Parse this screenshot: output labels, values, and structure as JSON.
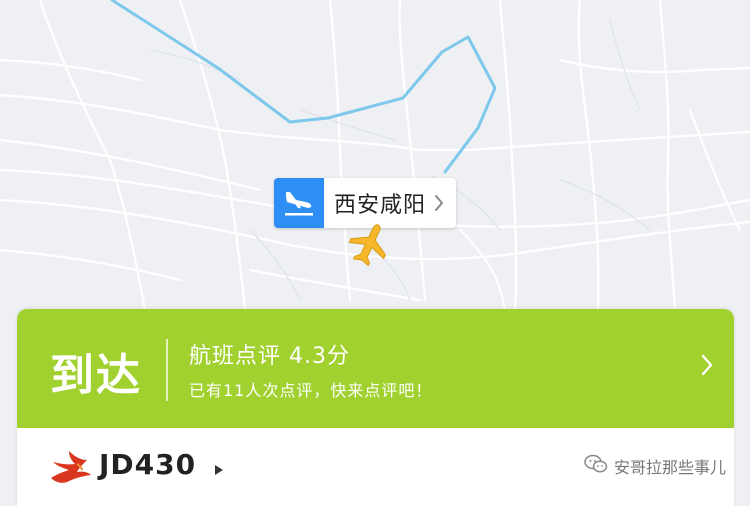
{
  "map": {
    "airport_label": "西安咸阳",
    "airport_icon": "plane-landing-icon",
    "aircraft_icon": "airplane-icon",
    "flight_path_color": "#7ec8ec",
    "aircraft_color": "#f6b82a"
  },
  "card": {
    "status": "到达",
    "status_color": "#a1d12e",
    "review_title": "航班点评 4.3分",
    "review_subtitle": "已有11人次点评，快来点评吧！",
    "flight_number": "JD430",
    "airline_logo": "airline-phoenix-logo"
  },
  "watermark": {
    "text": "安哥拉那些事儿",
    "icon": "wechat-icon"
  }
}
